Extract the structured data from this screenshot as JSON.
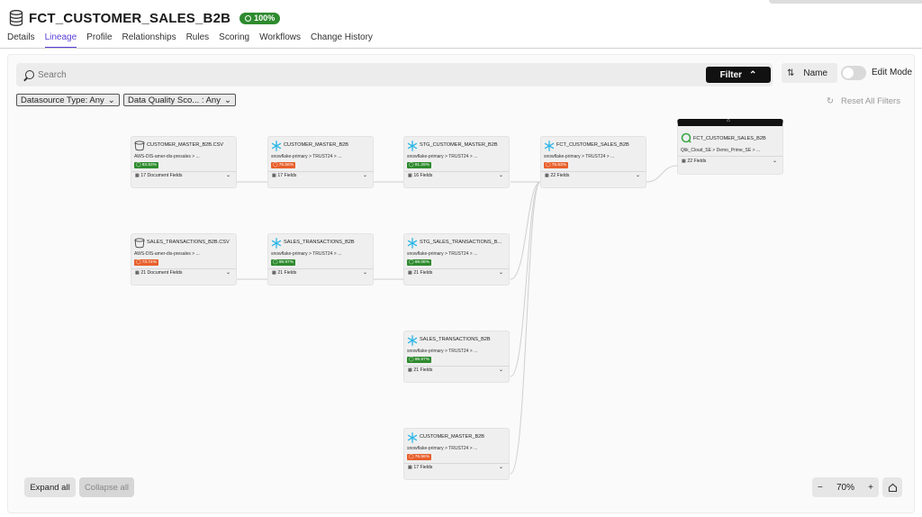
{
  "header": {
    "title": "FCT_CUSTOMER_SALES_B2B",
    "score": "100%"
  },
  "tabs": [
    {
      "label": "Details"
    },
    {
      "label": "Lineage"
    },
    {
      "label": "Profile"
    },
    {
      "label": "Relationships"
    },
    {
      "label": "Rules"
    },
    {
      "label": "Scoring"
    },
    {
      "label": "Workflows"
    },
    {
      "label": "Change History"
    }
  ],
  "active_tab": "Lineage",
  "search": {
    "placeholder": "Search",
    "filter_label": "Filter"
  },
  "sort": {
    "label": "Name"
  },
  "edit_mode": {
    "label": "Edit Mode",
    "enabled": false
  },
  "filters": {
    "datasource_type": "Datasource Type: Any",
    "data_quality": "Data Quality Sco... : Any",
    "reset_label": "Reset All Filters"
  },
  "nodes": [
    {
      "title": "CUSTOMER_MASTER_B2B.CSV",
      "path": "AWS-DIS-amer-dis-presales  >  ...",
      "score": "93.93%",
      "score_color": "#2e8b2e",
      "fields": "17 Document Fields",
      "icon": "bucket-icon"
    },
    {
      "title": "CUSTOMER_MASTER_B2B",
      "path": "snowflake-primary  >  TRUST24  >  ...",
      "score": "76.56%",
      "score_color": "#e8602c",
      "fields": "17 Fields",
      "icon": "snowflake-icon"
    },
    {
      "title": "STG_CUSTOMER_MASTER_B2B",
      "path": "snowflake-primary  >  TRUST24  >  ...",
      "score": "91.29%",
      "score_color": "#2e8b2e",
      "fields": "16 Fields",
      "icon": "snowflake-icon"
    },
    {
      "title": "FCT_CUSTOMER_SALES_B2B",
      "path": "snowflake-primary  >  TRUST24  >  ...",
      "score": "75.63%",
      "score_color": "#e8602c",
      "fields": "22 Fields",
      "icon": "snowflake-icon"
    },
    {
      "title": "FCT_CUSTOMER_SALES_B2B",
      "path": "Qlik_Cloud_SE  >  Demo_Prime_SE  >  ...",
      "score": "",
      "score_color": "",
      "fields": "22 Fields",
      "icon": "qlik-icon"
    },
    {
      "title": "SALES_TRANSACTIONS_B2B.CSV",
      "path": "AWS-DIS-amer-dis-presales  >  ...",
      "score": "73.74%",
      "score_color": "#e8602c",
      "fields": "21 Document Fields",
      "icon": "bucket-icon"
    },
    {
      "title": "SALES_TRANSACTIONS_B2B",
      "path": "snowflake-primary  >  TRUST24  >  ...",
      "score": "98.97%",
      "score_color": "#2e8b2e",
      "fields": "21 Fields",
      "icon": "snowflake-icon"
    },
    {
      "title": "STG_SALES_TRANSACTIONS_B...",
      "path": "snowflake-primary  >  TRUST24  >  ...",
      "score": "99.08%",
      "score_color": "#2e8b2e",
      "fields": "21 Fields",
      "icon": "snowflake-icon"
    },
    {
      "title": "SALES_TRANSACTIONS_B2B",
      "path": "snowflake-primary  >  TRUST24  >  ...",
      "score": "98.97%",
      "score_color": "#2e8b2e",
      "fields": "21 Fields",
      "icon": "snowflake-icon"
    },
    {
      "title": "CUSTOMER_MASTER_B2B",
      "path": "snowflake-primary  >  TRUST24  >  ...",
      "score": "76.56%",
      "score_color": "#e8602c",
      "fields": "17 Fields",
      "icon": "snowflake-icon"
    }
  ],
  "controls": {
    "expand_all": "Expand all",
    "collapse_all": "Collapse all",
    "zoom": "70%",
    "zoom_in": "+",
    "zoom_out": "−"
  },
  "colors": {
    "accent": "#5b3fd9",
    "good": "#2e8b2e",
    "warn": "#e8602c"
  }
}
